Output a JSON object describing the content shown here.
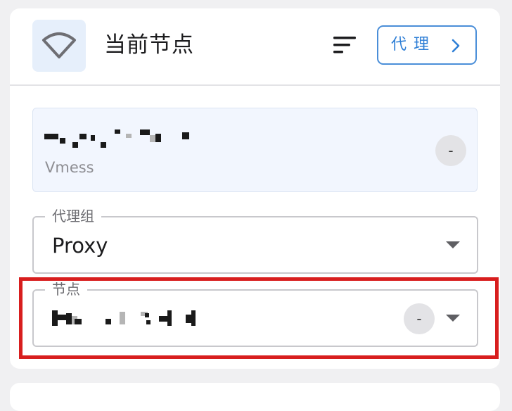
{
  "header": {
    "title": "当前节点",
    "proxy_button_label": "代理",
    "icons": {
      "wifi": "wifi-icon",
      "sort": "sort-icon",
      "chevron": "chevron-right-icon"
    }
  },
  "current_node": {
    "type": "Vmess",
    "delay": "-"
  },
  "proxy_group": {
    "label": "代理组",
    "value": "Proxy"
  },
  "node_select": {
    "label": "节点",
    "delay": "-"
  },
  "colors": {
    "accent": "#2f7fd6",
    "highlight": "#d81e1e",
    "tile_bg": "#e6effb"
  }
}
